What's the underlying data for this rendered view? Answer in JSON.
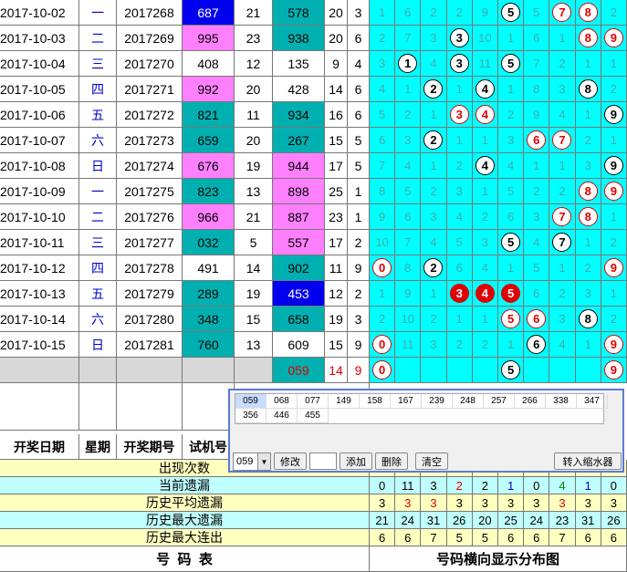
{
  "rows": [
    {
      "date": "2017-10-02",
      "wk": "一",
      "period": "2017268",
      "trial": "687",
      "tcolor": "blue",
      "n21": "21",
      "draw": "578",
      "dcolor": "teal",
      "sum": "20",
      "span": "3",
      "dist": [
        "1",
        "6",
        "2",
        "2",
        "9",
        "B5",
        "5",
        "R7",
        "R8",
        "2"
      ]
    },
    {
      "date": "2017-10-03",
      "wk": "二",
      "period": "2017269",
      "trial": "995",
      "tcolor": "magenta",
      "n21": "23",
      "draw": "938",
      "dcolor": "teal",
      "sum": "20",
      "span": "6",
      "dist": [
        "2",
        "7",
        "3",
        "B3",
        "10",
        "1",
        "6",
        "1",
        "R8",
        "R9"
      ]
    },
    {
      "date": "2017-10-04",
      "wk": "三",
      "period": "2017270",
      "trial": "408",
      "tcolor": "white",
      "n21": "12",
      "draw": "135",
      "dcolor": "white",
      "sum": "9",
      "span": "4",
      "dist": [
        "3",
        "B1",
        "4",
        "B3",
        "11",
        "B5",
        "7",
        "2",
        "1",
        "1"
      ]
    },
    {
      "date": "2017-10-05",
      "wk": "四",
      "period": "2017271",
      "trial": "992",
      "tcolor": "magenta",
      "n21": "20",
      "draw": "428",
      "dcolor": "white",
      "sum": "14",
      "span": "6",
      "dist": [
        "4",
        "1",
        "B2",
        "1",
        "B4",
        "1",
        "8",
        "3",
        "B8",
        "2"
      ]
    },
    {
      "date": "2017-10-06",
      "wk": "五",
      "period": "2017272",
      "trial": "821",
      "tcolor": "teal",
      "n21": "11",
      "draw": "934",
      "dcolor": "teal",
      "sum": "16",
      "span": "6",
      "dist": [
        "5",
        "2",
        "1",
        "R3",
        "R4",
        "2",
        "9",
        "4",
        "1",
        "B9"
      ]
    },
    {
      "date": "2017-10-07",
      "wk": "六",
      "period": "2017273",
      "trial": "659",
      "tcolor": "teal",
      "n21": "20",
      "draw": "267",
      "dcolor": "teal",
      "sum": "15",
      "span": "5",
      "dist": [
        "6",
        "3",
        "B2",
        "1",
        "1",
        "3",
        "R6",
        "R7",
        "2",
        "1"
      ]
    },
    {
      "date": "2017-10-08",
      "wk": "日",
      "period": "2017274",
      "trial": "676",
      "tcolor": "magenta",
      "n21": "19",
      "draw": "944",
      "dcolor": "magenta",
      "sum": "17",
      "span": "5",
      "dist": [
        "7",
        "4",
        "1",
        "2",
        "B4",
        "4",
        "1",
        "1",
        "3",
        "B9"
      ]
    },
    {
      "date": "2017-10-09",
      "wk": "一",
      "period": "2017275",
      "trial": "823",
      "tcolor": "teal",
      "n21": "13",
      "draw": "898",
      "dcolor": "magenta",
      "sum": "25",
      "span": "1",
      "dist": [
        "8",
        "5",
        "2",
        "3",
        "1",
        "5",
        "2",
        "2",
        "R8",
        "R9"
      ]
    },
    {
      "date": "2017-10-10",
      "wk": "二",
      "period": "2017276",
      "trial": "966",
      "tcolor": "magenta",
      "n21": "21",
      "draw": "887",
      "dcolor": "magenta",
      "sum": "23",
      "span": "1",
      "dist": [
        "9",
        "6",
        "3",
        "4",
        "2",
        "6",
        "3",
        "R7",
        "R8",
        "1"
      ]
    },
    {
      "date": "2017-10-11",
      "wk": "三",
      "period": "2017277",
      "trial": "032",
      "tcolor": "teal",
      "n21": "5",
      "draw": "557",
      "dcolor": "magenta",
      "sum": "17",
      "span": "2",
      "dist": [
        "10",
        "7",
        "4",
        "5",
        "3",
        "B5",
        "4",
        "B7",
        "1",
        "2"
      ]
    },
    {
      "date": "2017-10-12",
      "wk": "四",
      "period": "2017278",
      "trial": "491",
      "tcolor": "white",
      "n21": "14",
      "draw": "902",
      "dcolor": "teal",
      "sum": "11",
      "span": "9",
      "dist": [
        "R0",
        "8",
        "B2",
        "6",
        "4",
        "1",
        "5",
        "1",
        "2",
        "R9"
      ]
    },
    {
      "date": "2017-10-13",
      "wk": "五",
      "period": "2017279",
      "trial": "289",
      "tcolor": "teal",
      "n21": "19",
      "draw": "453",
      "dcolor": "blue",
      "sum": "12",
      "span": "2",
      "dist": [
        "1",
        "9",
        "1",
        "F3",
        "F4",
        "F5",
        "6",
        "2",
        "3",
        "1"
      ]
    },
    {
      "date": "2017-10-14",
      "wk": "六",
      "period": "2017280",
      "trial": "348",
      "tcolor": "teal",
      "n21": "15",
      "draw": "658",
      "dcolor": "teal",
      "sum": "19",
      "span": "3",
      "dist": [
        "2",
        "10",
        "2",
        "1",
        "1",
        "R5",
        "R6",
        "3",
        "B8",
        "2"
      ]
    },
    {
      "date": "2017-10-15",
      "wk": "日",
      "period": "2017281",
      "trial": "760",
      "tcolor": "teal",
      "n21": "13",
      "draw": "609",
      "dcolor": "white",
      "sum": "15",
      "span": "9",
      "dist": [
        "R0",
        "11",
        "3",
        "2",
        "2",
        "1",
        "B6",
        "4",
        "1",
        "R9"
      ]
    }
  ],
  "current": {
    "draw": "059",
    "sum": "14",
    "span": "9",
    "dist": [
      "R0",
      "",
      "",
      "",
      "",
      "B5",
      "",
      "",
      "",
      "R9"
    ]
  },
  "headers": {
    "date": "开奖日期",
    "wk": "星期",
    "period": "开奖期号",
    "trial": "试机号"
  },
  "stats": [
    {
      "label": "出现次数",
      "values": [
        "",
        "",
        "",
        "",
        "",
        "",
        "",
        "",
        "",
        ""
      ]
    },
    {
      "label": "当前遗漏",
      "values": [
        "0",
        "11",
        "3",
        "2",
        "2",
        "1",
        "0",
        "4",
        "1",
        "0"
      ]
    },
    {
      "label": "历史平均遗漏",
      "values": [
        "3",
        "3",
        "3",
        "3",
        "3",
        "3",
        "3",
        "3",
        "3",
        "3"
      ]
    },
    {
      "label": "历史最大遗漏",
      "values": [
        "21",
        "24",
        "31",
        "26",
        "20",
        "25",
        "24",
        "23",
        "31",
        "26"
      ]
    },
    {
      "label": "历史最大连出",
      "values": [
        "6",
        "6",
        "7",
        "5",
        "5",
        "6",
        "6",
        "7",
        "6",
        "6"
      ]
    }
  ],
  "stats_colors": {
    "当前遗漏": [
      "#000",
      "#000",
      "#000",
      "#e00000",
      "#000",
      "#0000cc",
      "#000",
      "#008800",
      "#0000cc",
      "#000"
    ],
    "历史平均遗漏": [
      "#000",
      "#e00000",
      "#e00000",
      "#000",
      "#000",
      "#000",
      "#000",
      "#e00000",
      "#000",
      "#000"
    ]
  },
  "footer": {
    "left": "号  码  表",
    "right": "号码横向显示分布图"
  },
  "dialog": {
    "numbers": [
      "059",
      "068",
      "077",
      "149",
      "158",
      "167",
      "239",
      "248",
      "257",
      "266",
      "338",
      "347",
      "356",
      "446",
      "455"
    ],
    "select_value": "059",
    "btn_edit": "修改",
    "input_value": "",
    "btn_add": "添加",
    "btn_delete": "删除",
    "btn_clear": "清空",
    "btn_transfer": "转入缩水器"
  },
  "colors": {
    "cyan": "#00ffff",
    "teal": "#00b0b0",
    "magenta": "#ff80ff",
    "blue": "#0000ee",
    "stat_yellow": "#ffffc0",
    "stat_cyan": "#c0ffff"
  }
}
